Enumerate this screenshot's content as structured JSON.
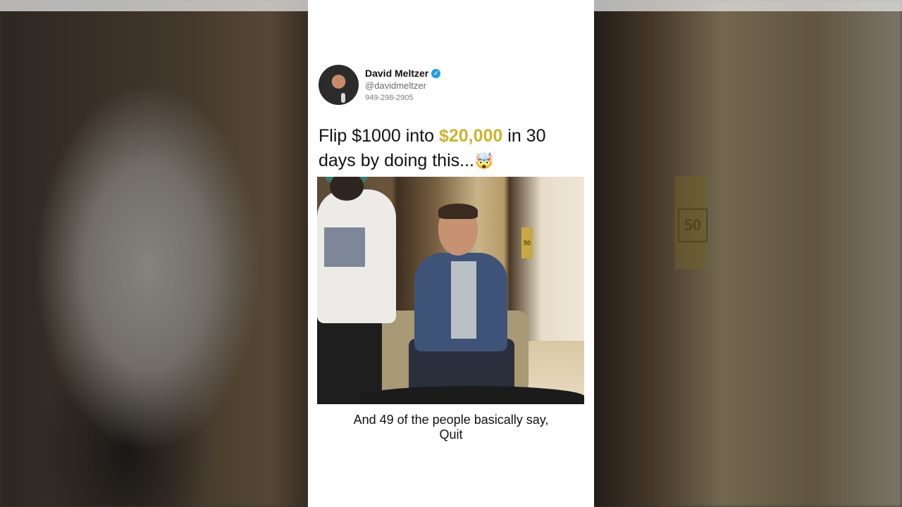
{
  "background": {
    "sign_text": "50"
  },
  "post": {
    "author_name": "David Meltzer",
    "verified": true,
    "handle": "@davidmeltzer",
    "phone": "949-298-2905",
    "headline_part1": "Flip $1000 into ",
    "headline_highlight": "$20,000",
    "headline_part2": " in 30 days by doing this...",
    "headline_emoji": "🤯",
    "highlight_color": "#cdb42d",
    "verified_color": "#1d9bf0"
  },
  "video": {
    "sign_text": "50",
    "caption_line1": "And 49 of the people basically say,",
    "caption_line2": "Quit"
  }
}
